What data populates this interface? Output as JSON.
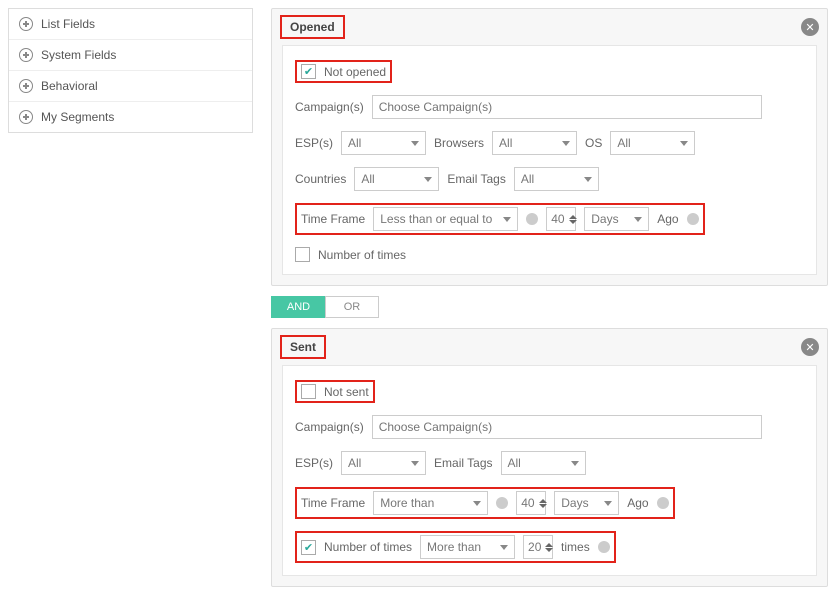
{
  "sidebar": {
    "items": [
      {
        "label": "List Fields"
      },
      {
        "label": "System Fields"
      },
      {
        "label": "Behavioral"
      },
      {
        "label": "My Segments"
      }
    ]
  },
  "logic": {
    "and": "AND",
    "or": "OR"
  },
  "labels": {
    "campaign": "Campaign(s)",
    "esp": "ESP(s)",
    "browsers": "Browsers",
    "os": "OS",
    "countries": "Countries",
    "emailTags": "Email Tags",
    "timeFrame": "Time Frame",
    "numberOfTimes": "Number of times",
    "ago": "Ago",
    "times": "times",
    "campaignPlaceholder": "Choose Campaign(s)"
  },
  "rule1": {
    "title": "Opened",
    "notLabel": "Not opened",
    "notChecked": true,
    "esp": "All",
    "browsers": "All",
    "os": "All",
    "countries": "All",
    "emailTags": "All",
    "tfOp": "Less than or equal to",
    "tfValue": "40",
    "tfUnit": "Days",
    "numTimesChecked": false
  },
  "rule2": {
    "title": "Sent",
    "notLabel": "Not sent",
    "notChecked": false,
    "esp": "All",
    "emailTags": "All",
    "tfOp": "More than",
    "tfValue": "40",
    "tfUnit": "Days",
    "numTimesChecked": true,
    "numTimesOp": "More than",
    "numTimesValue": "20"
  }
}
